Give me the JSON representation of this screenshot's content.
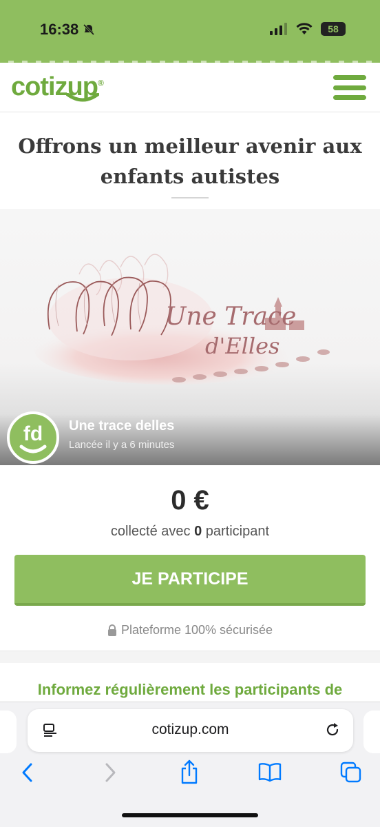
{
  "status": {
    "time": "16:38",
    "battery": "58"
  },
  "header": {
    "logo": "cotizup",
    "logo_mark": "®"
  },
  "page": {
    "title": "Offrons un meilleur avenir aux enfants autistes"
  },
  "hero": {
    "artwork_text_line1": "Une Trace",
    "artwork_text_line2": "d'Elles",
    "avatar_text": "fd",
    "organizer_name": "Une trace delles",
    "launched": "Lancée il y a 6 minutes"
  },
  "funding": {
    "amount": "0 €",
    "collected_prefix": "collecté avec ",
    "participants": "0",
    "collected_suffix": " participant",
    "cta_label": "JE PARTICIPE",
    "secure_label": "Plateforme 100% sécurisée"
  },
  "info": {
    "headline": "Informez régulièrement les participants de"
  },
  "browser": {
    "url": "cotizup.com"
  },
  "colors": {
    "brand_green": "#8fbe5f",
    "logo_green": "#6faa3e",
    "ios_blue": "#007aff"
  },
  "icons": [
    "bell-slash-icon",
    "signal-icon",
    "wifi-icon",
    "battery-icon",
    "menu-icon",
    "lock-icon",
    "reader-icon",
    "reload-icon",
    "back-icon",
    "forward-icon",
    "share-icon",
    "bookmarks-icon",
    "tabs-icon"
  ]
}
